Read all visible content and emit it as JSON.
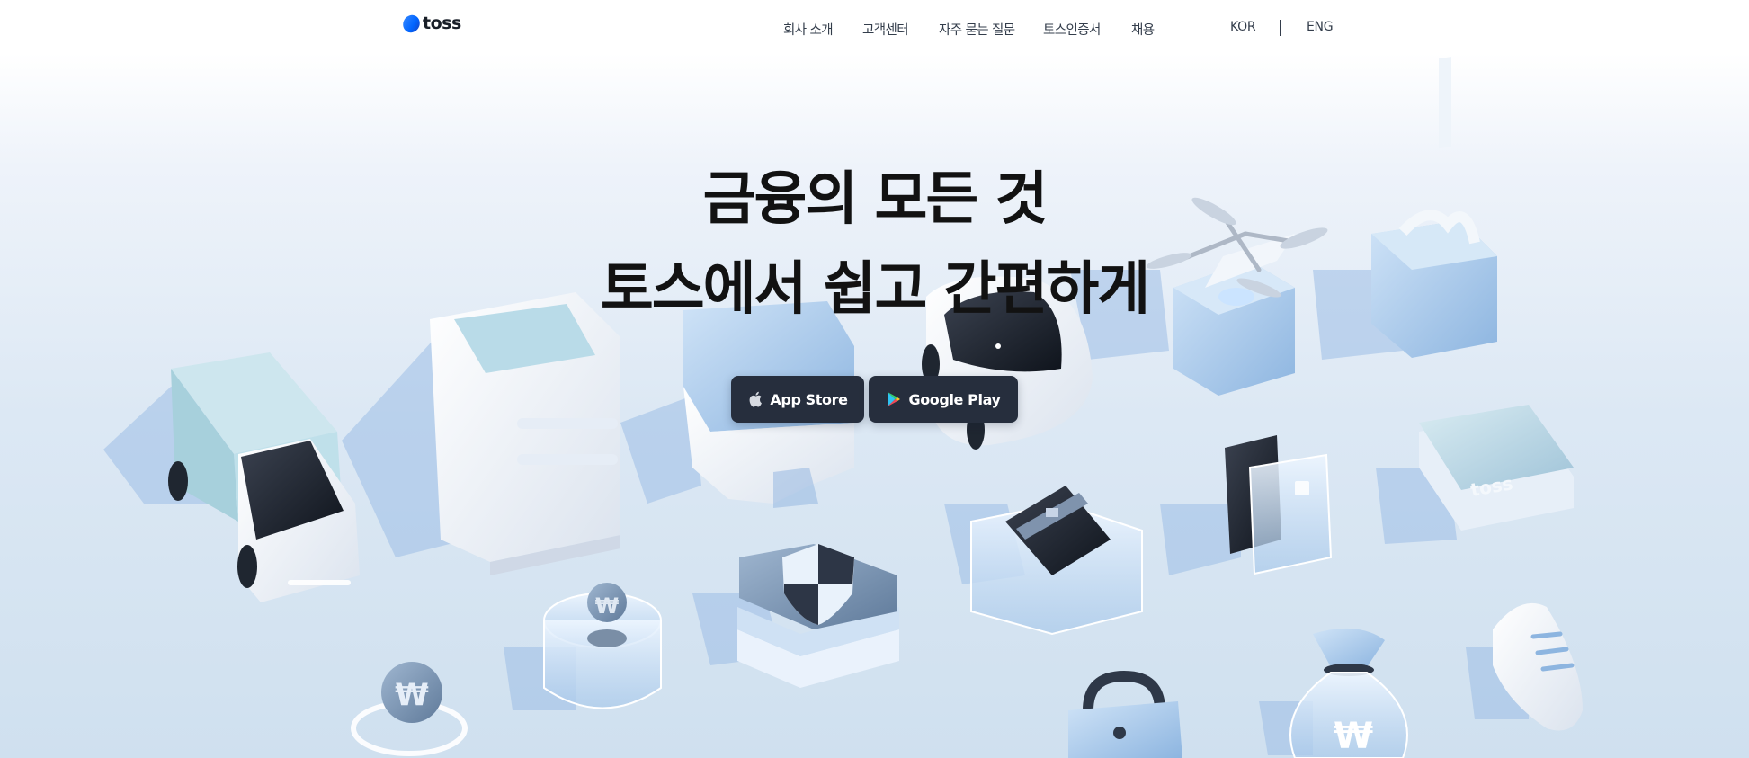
{
  "header": {
    "logo_text": "toss",
    "nav": [
      "회사 소개",
      "고객센터",
      "자주 묻는 질문",
      "토스인증서",
      "채용"
    ],
    "lang": {
      "kor": "KOR",
      "eng": "ENG"
    }
  },
  "hero": {
    "title_line1": "금융의 모든 것",
    "title_line2": "토스에서 쉽고 간편하게",
    "app_store_label": "App Store",
    "google_play_label": "Google Play"
  },
  "illustration": {
    "card_logo_text": "toss",
    "won_symbol": "₩",
    "objects": [
      "truck-icon",
      "atm-icon",
      "locker-icon",
      "car-icon",
      "drone-icon",
      "gift-icon",
      "coin-icon",
      "jar-icon",
      "shield-icon",
      "card-icon",
      "cards-icon",
      "toss-card-icon",
      "lock-icon",
      "money-bag-icon",
      "shoe-icon"
    ]
  },
  "colors": {
    "brand": "#0064ff",
    "button_bg": "#262e3d",
    "title": "#121212"
  }
}
